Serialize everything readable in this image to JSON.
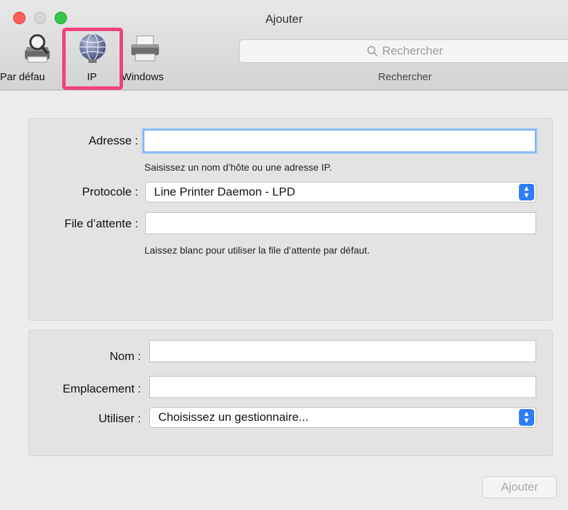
{
  "window": {
    "title": "Ajouter"
  },
  "toolbar": {
    "default_label": "Par défau",
    "ip_label": "IP",
    "windows_label": "Windows",
    "search_placeholder": "Rechercher",
    "search_caption": "Rechercher"
  },
  "form": {
    "address_label": "Adresse :",
    "address_value": "",
    "address_hint": "Saisissez un nom d’hôte ou une adresse IP.",
    "protocol_label": "Protocole :",
    "protocol_value": "Line Printer Daemon - LPD",
    "queue_label": "File d’attente :",
    "queue_value": "",
    "queue_hint": "Laissez blanc pour utiliser la file d’attente par défaut.",
    "name_label": "Nom :",
    "name_value": "",
    "location_label": "Emplacement :",
    "location_value": "",
    "use_label": "Utiliser :",
    "use_value": "Choisissez un gestionnaire..."
  },
  "footer": {
    "add_button": "Ajouter"
  },
  "colors": {
    "highlight": "#f1417a",
    "accent": "#2e7cf6"
  }
}
